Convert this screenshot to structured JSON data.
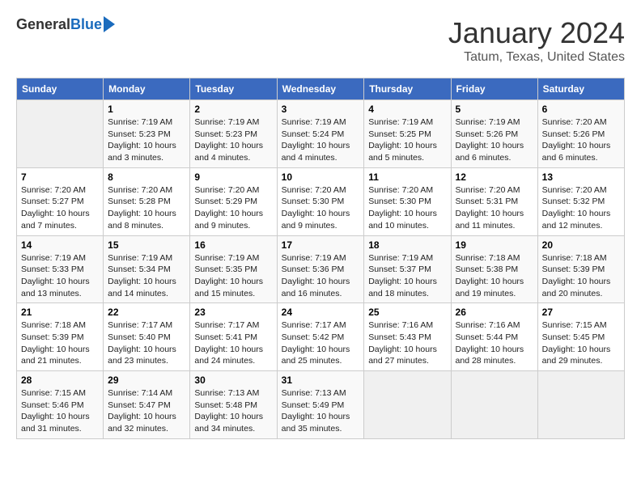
{
  "header": {
    "logo_general": "General",
    "logo_blue": "Blue",
    "title": "January 2024",
    "subtitle": "Tatum, Texas, United States"
  },
  "days_of_week": [
    "Sunday",
    "Monday",
    "Tuesday",
    "Wednesday",
    "Thursday",
    "Friday",
    "Saturday"
  ],
  "weeks": [
    [
      {
        "num": "",
        "info": ""
      },
      {
        "num": "1",
        "info": "Sunrise: 7:19 AM\nSunset: 5:23 PM\nDaylight: 10 hours\nand 3 minutes."
      },
      {
        "num": "2",
        "info": "Sunrise: 7:19 AM\nSunset: 5:23 PM\nDaylight: 10 hours\nand 4 minutes."
      },
      {
        "num": "3",
        "info": "Sunrise: 7:19 AM\nSunset: 5:24 PM\nDaylight: 10 hours\nand 4 minutes."
      },
      {
        "num": "4",
        "info": "Sunrise: 7:19 AM\nSunset: 5:25 PM\nDaylight: 10 hours\nand 5 minutes."
      },
      {
        "num": "5",
        "info": "Sunrise: 7:19 AM\nSunset: 5:26 PM\nDaylight: 10 hours\nand 6 minutes."
      },
      {
        "num": "6",
        "info": "Sunrise: 7:20 AM\nSunset: 5:26 PM\nDaylight: 10 hours\nand 6 minutes."
      }
    ],
    [
      {
        "num": "7",
        "info": "Sunrise: 7:20 AM\nSunset: 5:27 PM\nDaylight: 10 hours\nand 7 minutes."
      },
      {
        "num": "8",
        "info": "Sunrise: 7:20 AM\nSunset: 5:28 PM\nDaylight: 10 hours\nand 8 minutes."
      },
      {
        "num": "9",
        "info": "Sunrise: 7:20 AM\nSunset: 5:29 PM\nDaylight: 10 hours\nand 9 minutes."
      },
      {
        "num": "10",
        "info": "Sunrise: 7:20 AM\nSunset: 5:30 PM\nDaylight: 10 hours\nand 9 minutes."
      },
      {
        "num": "11",
        "info": "Sunrise: 7:20 AM\nSunset: 5:30 PM\nDaylight: 10 hours\nand 10 minutes."
      },
      {
        "num": "12",
        "info": "Sunrise: 7:20 AM\nSunset: 5:31 PM\nDaylight: 10 hours\nand 11 minutes."
      },
      {
        "num": "13",
        "info": "Sunrise: 7:20 AM\nSunset: 5:32 PM\nDaylight: 10 hours\nand 12 minutes."
      }
    ],
    [
      {
        "num": "14",
        "info": "Sunrise: 7:19 AM\nSunset: 5:33 PM\nDaylight: 10 hours\nand 13 minutes."
      },
      {
        "num": "15",
        "info": "Sunrise: 7:19 AM\nSunset: 5:34 PM\nDaylight: 10 hours\nand 14 minutes."
      },
      {
        "num": "16",
        "info": "Sunrise: 7:19 AM\nSunset: 5:35 PM\nDaylight: 10 hours\nand 15 minutes."
      },
      {
        "num": "17",
        "info": "Sunrise: 7:19 AM\nSunset: 5:36 PM\nDaylight: 10 hours\nand 16 minutes."
      },
      {
        "num": "18",
        "info": "Sunrise: 7:19 AM\nSunset: 5:37 PM\nDaylight: 10 hours\nand 18 minutes."
      },
      {
        "num": "19",
        "info": "Sunrise: 7:18 AM\nSunset: 5:38 PM\nDaylight: 10 hours\nand 19 minutes."
      },
      {
        "num": "20",
        "info": "Sunrise: 7:18 AM\nSunset: 5:39 PM\nDaylight: 10 hours\nand 20 minutes."
      }
    ],
    [
      {
        "num": "21",
        "info": "Sunrise: 7:18 AM\nSunset: 5:39 PM\nDaylight: 10 hours\nand 21 minutes."
      },
      {
        "num": "22",
        "info": "Sunrise: 7:17 AM\nSunset: 5:40 PM\nDaylight: 10 hours\nand 23 minutes."
      },
      {
        "num": "23",
        "info": "Sunrise: 7:17 AM\nSunset: 5:41 PM\nDaylight: 10 hours\nand 24 minutes."
      },
      {
        "num": "24",
        "info": "Sunrise: 7:17 AM\nSunset: 5:42 PM\nDaylight: 10 hours\nand 25 minutes."
      },
      {
        "num": "25",
        "info": "Sunrise: 7:16 AM\nSunset: 5:43 PM\nDaylight: 10 hours\nand 27 minutes."
      },
      {
        "num": "26",
        "info": "Sunrise: 7:16 AM\nSunset: 5:44 PM\nDaylight: 10 hours\nand 28 minutes."
      },
      {
        "num": "27",
        "info": "Sunrise: 7:15 AM\nSunset: 5:45 PM\nDaylight: 10 hours\nand 29 minutes."
      }
    ],
    [
      {
        "num": "28",
        "info": "Sunrise: 7:15 AM\nSunset: 5:46 PM\nDaylight: 10 hours\nand 31 minutes."
      },
      {
        "num": "29",
        "info": "Sunrise: 7:14 AM\nSunset: 5:47 PM\nDaylight: 10 hours\nand 32 minutes."
      },
      {
        "num": "30",
        "info": "Sunrise: 7:13 AM\nSunset: 5:48 PM\nDaylight: 10 hours\nand 34 minutes."
      },
      {
        "num": "31",
        "info": "Sunrise: 7:13 AM\nSunset: 5:49 PM\nDaylight: 10 hours\nand 35 minutes."
      },
      {
        "num": "",
        "info": ""
      },
      {
        "num": "",
        "info": ""
      },
      {
        "num": "",
        "info": ""
      }
    ]
  ]
}
